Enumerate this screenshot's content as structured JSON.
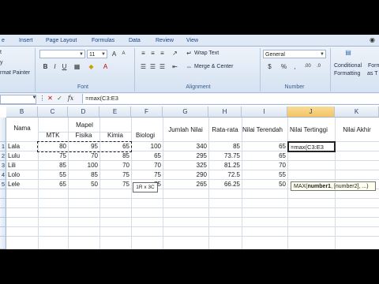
{
  "ribbon": {
    "tabs": [
      "e",
      "Insert",
      "Page Layout",
      "Formulas",
      "Data",
      "Review",
      "View"
    ],
    "clipboard": {
      "cut": "t",
      "copy": "y",
      "format_painter": "rmat Painter"
    },
    "font": {
      "size": "11",
      "label": "Font",
      "bold": "B",
      "italic": "I",
      "underline": "U"
    },
    "alignment": {
      "wrap_text": "Wrap Text",
      "merge_center": "Merge & Center",
      "label": "Alignment"
    },
    "number": {
      "format": "General",
      "currency": "$",
      "percent": "%",
      "comma": ",",
      "dec_inc": ".00",
      "dec_dec": ".0",
      "label": "Number"
    },
    "styles": {
      "conditional": "Conditional",
      "formatting": "Formatting",
      "as_t": "as T",
      "format": "Format",
      "as_ta": "as Ta"
    }
  },
  "formula_bar": {
    "fx": "fx",
    "value": "=max(C3:E3"
  },
  "columns": [
    "B",
    "C",
    "D",
    "E",
    "F",
    "G",
    "H",
    "I",
    "J",
    "K"
  ],
  "rows": [
    "",
    "",
    "1",
    "2",
    "3",
    "4",
    "5",
    "",
    "",
    "",
    ""
  ],
  "headers": {
    "nama": "Nama",
    "mapel": "Mapel",
    "mtk": "MTK",
    "fisika": "Fisika",
    "kimia": "Kimia",
    "biologi": "Biologi",
    "jumlah": "Jumlah Nilai",
    "rata": "Rata-rata",
    "terendah": "Nilai Terendah",
    "tertinggi": "Nilai Tertinggi",
    "akhir": "Nilai Akhir"
  },
  "table": [
    {
      "no": "1",
      "nama": "Lala",
      "mtk": "80",
      "fisika": "95",
      "kimia": "65",
      "biologi": "100",
      "jumlah": "340",
      "rata": "85",
      "terendah": "65"
    },
    {
      "no": "2",
      "nama": "Lulu",
      "mtk": "75",
      "fisika": "70",
      "kimia": "85",
      "biologi": "65",
      "jumlah": "295",
      "rata": "73.75",
      "terendah": "65"
    },
    {
      "no": "3",
      "nama": "Lili",
      "mtk": "85",
      "fisika": "100",
      "kimia": "70",
      "biologi": "70",
      "jumlah": "325",
      "rata": "81.25",
      "terendah": "70"
    },
    {
      "no": "4",
      "nama": "Lolo",
      "mtk": "55",
      "fisika": "85",
      "kimia": "75",
      "biologi": "75",
      "jumlah": "290",
      "rata": "72.5",
      "terendah": "55"
    },
    {
      "no": "5",
      "nama": "Lele",
      "mtk": "65",
      "fisika": "50",
      "kimia": "75",
      "biologi": "75",
      "jumlah": "265",
      "rata": "66.25",
      "terendah": "50"
    }
  ],
  "editing": {
    "cell_text": "=max(C3:E3",
    "range_size_tip": "1R x 3C",
    "tip_fn": "MAX(",
    "tip_arg1": "number1",
    "tip_rest": ", [number2], ...)"
  },
  "colors": {
    "accent": "#15428b",
    "selected_header": "#f2c463"
  }
}
